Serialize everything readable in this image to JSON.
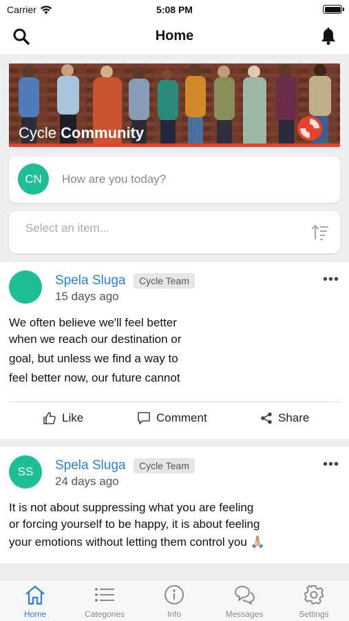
{
  "status_bar": {
    "carrier": "Carrier",
    "time": "5:08 PM"
  },
  "nav": {
    "title": "Home"
  },
  "banner": {
    "caption_light": "Cycle ",
    "caption_bold": "Community"
  },
  "composer": {
    "avatar_initials": "CN",
    "placeholder": "How are you today?"
  },
  "filter": {
    "placeholder": "Select an item..."
  },
  "posts": [
    {
      "author": "Spela Sluga",
      "badge": "Cycle Team",
      "time": "15 days ago",
      "avatar_initials": "",
      "lines": [
        "We often believe we'll feel better",
        "when we reach our destination or",
        "goal, but unless we find a way to",
        "feel better now, our future cannot"
      ],
      "actions": {
        "like": "Like",
        "comment": "Comment",
        "share": "Share"
      }
    },
    {
      "author": "Spela Sluga",
      "badge": "Cycle Team",
      "time": "24 days ago",
      "avatar_initials": "SS",
      "lines": [
        "It is not about suppressing what you are feeling",
        "or forcing yourself to be happy, it is about feeling",
        "your emotions without letting them control you 🙏🏼"
      ]
    }
  ],
  "tabs": [
    {
      "label": "Home",
      "icon": "home-icon",
      "active": true
    },
    {
      "label": "Categories",
      "icon": "list-icon",
      "active": false
    },
    {
      "label": "Info",
      "icon": "info-icon",
      "active": false
    },
    {
      "label": "Messages",
      "icon": "chat-icon",
      "active": false
    },
    {
      "label": "Settings",
      "icon": "gear-icon",
      "active": false
    }
  ],
  "colors": {
    "accent": "#2a7ee0",
    "avatar": "#1ebe97",
    "banner_strip": "#e5432c"
  }
}
